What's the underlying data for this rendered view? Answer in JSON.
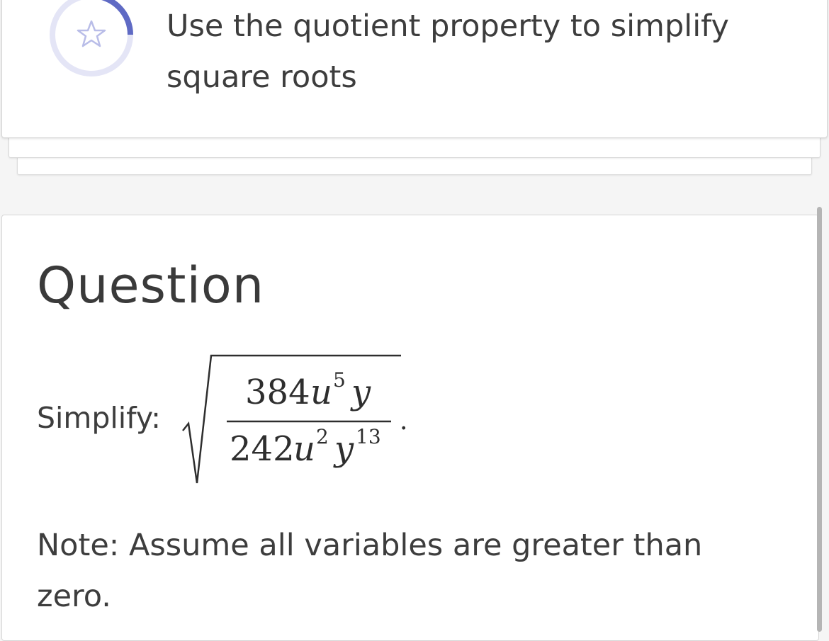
{
  "objective": {
    "title": "Use the quotient property to simplify square roots",
    "icon": "star-icon",
    "accent_color": "#5f6ac4",
    "ring_color": "#e4e5f6"
  },
  "question": {
    "heading": "Question",
    "prompt": "Simplify:",
    "expression": {
      "numerator": {
        "coefficient": "384",
        "var1": "u",
        "exp1": "5",
        "var2": "y"
      },
      "denominator": {
        "coefficient": "242",
        "var1": "u",
        "exp1": "2",
        "var2": "y",
        "exp2": "13"
      },
      "trailing": "."
    },
    "note": "Note: Assume all variables are greater than zero."
  }
}
